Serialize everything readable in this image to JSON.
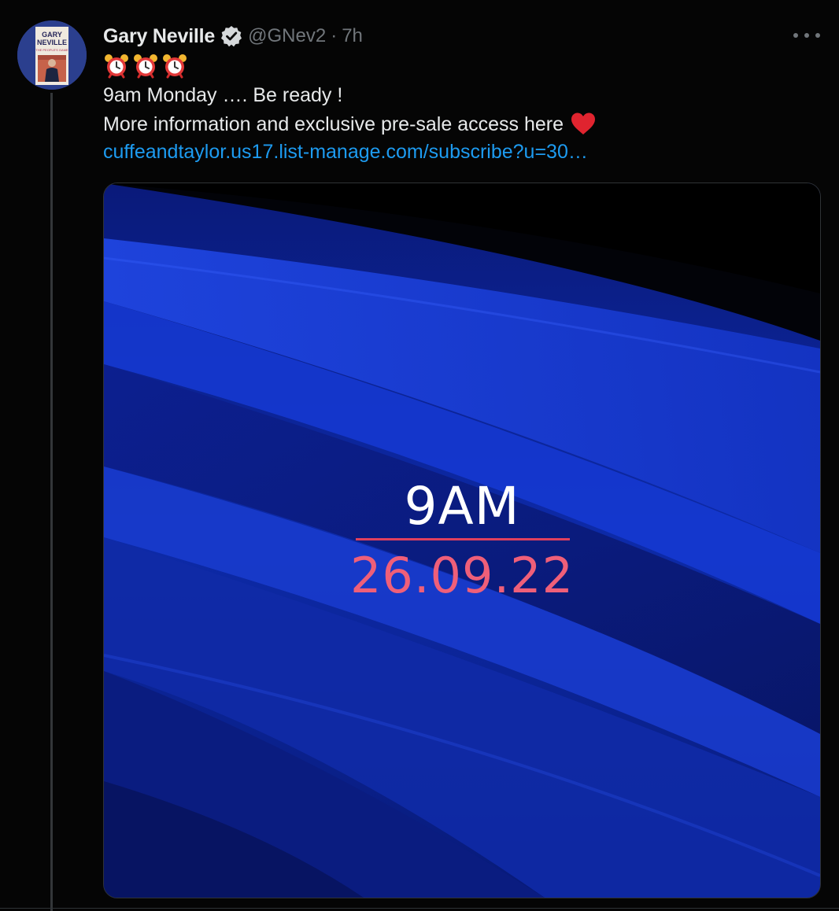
{
  "tweet": {
    "author_name": "Gary Neville",
    "handle": "@GNev2",
    "separator": "·",
    "timestamp": "7h",
    "emoji": [
      "⏰",
      "⏰",
      "⏰"
    ],
    "text_line_1": "9am Monday …. Be ready !",
    "text_line_2": "More information and exclusive pre-sale access here",
    "link_text": "cuffeandtaylor.us17.list-manage.com/subscribe?u=30…",
    "verified": true
  },
  "avatar": {
    "book_title_1": "GARY",
    "book_title_2": "NEVILLE",
    "book_subtitle": "THE PEOPLE'S GAME"
  },
  "media": {
    "time_text": "9AM",
    "date_text": "26.09.22"
  },
  "icons": {
    "more": "more-options-icon",
    "verified": "verified-badge-icon",
    "alarm": "alarm-clock-emoji",
    "heart": "red-heart-emoji"
  },
  "colors": {
    "background": "#000000",
    "text_primary": "#e7e9ea",
    "text_secondary": "#71767b",
    "link": "#1d9bf0",
    "media_blue": "#1e3fd4",
    "date_red": "#ef5f79"
  }
}
